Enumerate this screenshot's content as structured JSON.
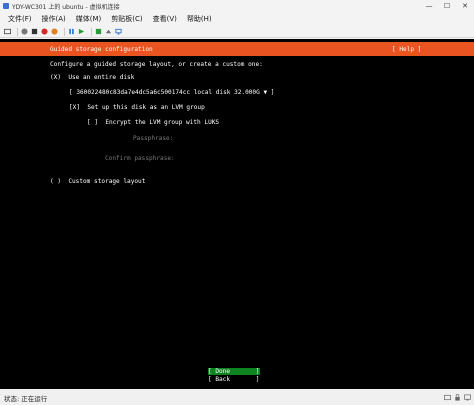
{
  "window": {
    "title": "YDY-WC301 上的 ubuntu - 虚拟机连接",
    "minimize_glyph": "—",
    "maximize_glyph": "☐",
    "close_glyph": "✕"
  },
  "menu": {
    "items": [
      "文件(F)",
      "操作(A)",
      "媒体(M)",
      "剪贴板(C)",
      "查看(V)",
      "帮助(H)"
    ]
  },
  "toolbar": {
    "icons": [
      "ctrl-alt-del-icon",
      "start-icon",
      "turn-off-icon",
      "shutdown-icon",
      "power-icon",
      "pause-icon",
      "reset-icon",
      "checkpoint-icon",
      "revert-icon",
      "enhanced-session-icon"
    ]
  },
  "installer": {
    "header_title": "Guided storage configuration",
    "help_label": "[ Help ]",
    "intro": "Configure a guided storage layout, or create a custom one:",
    "use_entire_disk": "(X)  Use an entire disk",
    "disk_select": "[ 360022480c83da7e4dc5a6c500174cc local disk 32.000G ▼ ]",
    "lvm_option": "[X]  Set up this disk as an LVM group",
    "luks_option": "[ ]  Encrypt the LVM group with LUKS",
    "passphrase_label": "Passphrase:",
    "confirm_passphrase_label": "Confirm passphrase:",
    "custom_layout": "( )  Custom storage layout",
    "done_button": "[ Done       ]",
    "back_button": "[ Back       ]",
    "header_color": "#e95420",
    "done_color": "#0e8420"
  },
  "status": {
    "text": "状态: 正在运行"
  }
}
